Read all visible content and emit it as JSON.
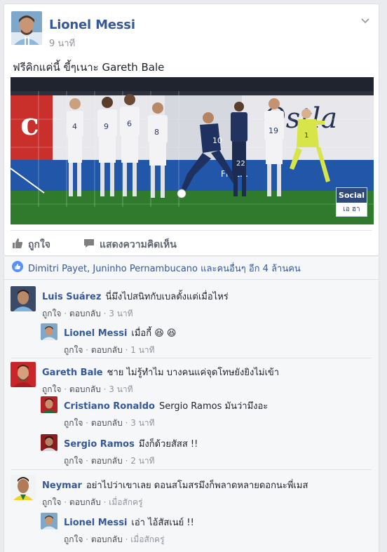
{
  "post": {
    "author": "Lionel Messi",
    "time": "9 นาที",
    "text": "ฟรีคิกแค่นี้ ขี้ๆเนาะ Gareth Bale",
    "photo": {
      "badge_top": "Social",
      "badge_bottom": "เอ ฮา",
      "player_numbers": [
        "4",
        "9",
        "6",
        "8",
        "10",
        "22",
        "19",
        "1"
      ]
    }
  },
  "actions": {
    "like": "ถูกใจ",
    "comment": "แสดงความคิดเห็น"
  },
  "likes_summary": "Dimitri Payet, Juninho Pernambucano และคนอื่นๆ อีก 4 ล้านคน",
  "comment_meta": {
    "like": "ถูกใจ",
    "reply": "ตอบกลับ",
    "dot": "·"
  },
  "comments": [
    {
      "name": "Luis Suárez",
      "text": "นี่มึงไปสนิทกับเบลตั้งแต่เมื่อไหร่",
      "time": "3 นาที",
      "replies": [
        {
          "name": "Lionel Messi",
          "text": "เมื่อกี้ 😆 😆",
          "time": "1 นาที"
        }
      ]
    },
    {
      "name": "Gareth Bale",
      "text": "ชาย ไม่รู้ทำไม บางคนแค่จุดโทษยังยิงไม่เข้า",
      "time": "3 นาที",
      "replies": [
        {
          "name": "Cristiano Ronaldo",
          "text": "Sergio Ramos มันว่ามึงอะ",
          "time": "3 นาที"
        },
        {
          "name": "Sergio Ramos",
          "text": "มึงก็ด้วยสัสส !!",
          "time": "2 นาที"
        }
      ]
    },
    {
      "name": "Neymar",
      "text": "อย่าไปว่าเขาเลย ดอนสโมสรมึงก็พลาดหลายดอกนะพี่เมส",
      "time": "เมื่อสักครู่",
      "replies": [
        {
          "name": "Lionel Messi",
          "text": "เอ่า ไอ้สัสเนย์ !!",
          "time": "เมื่อสักครู่"
        }
      ]
    }
  ],
  "colors": {
    "link": "#365899",
    "meta": "#90949c",
    "like_badge": "#5890ff",
    "background": "#e9ebee"
  }
}
